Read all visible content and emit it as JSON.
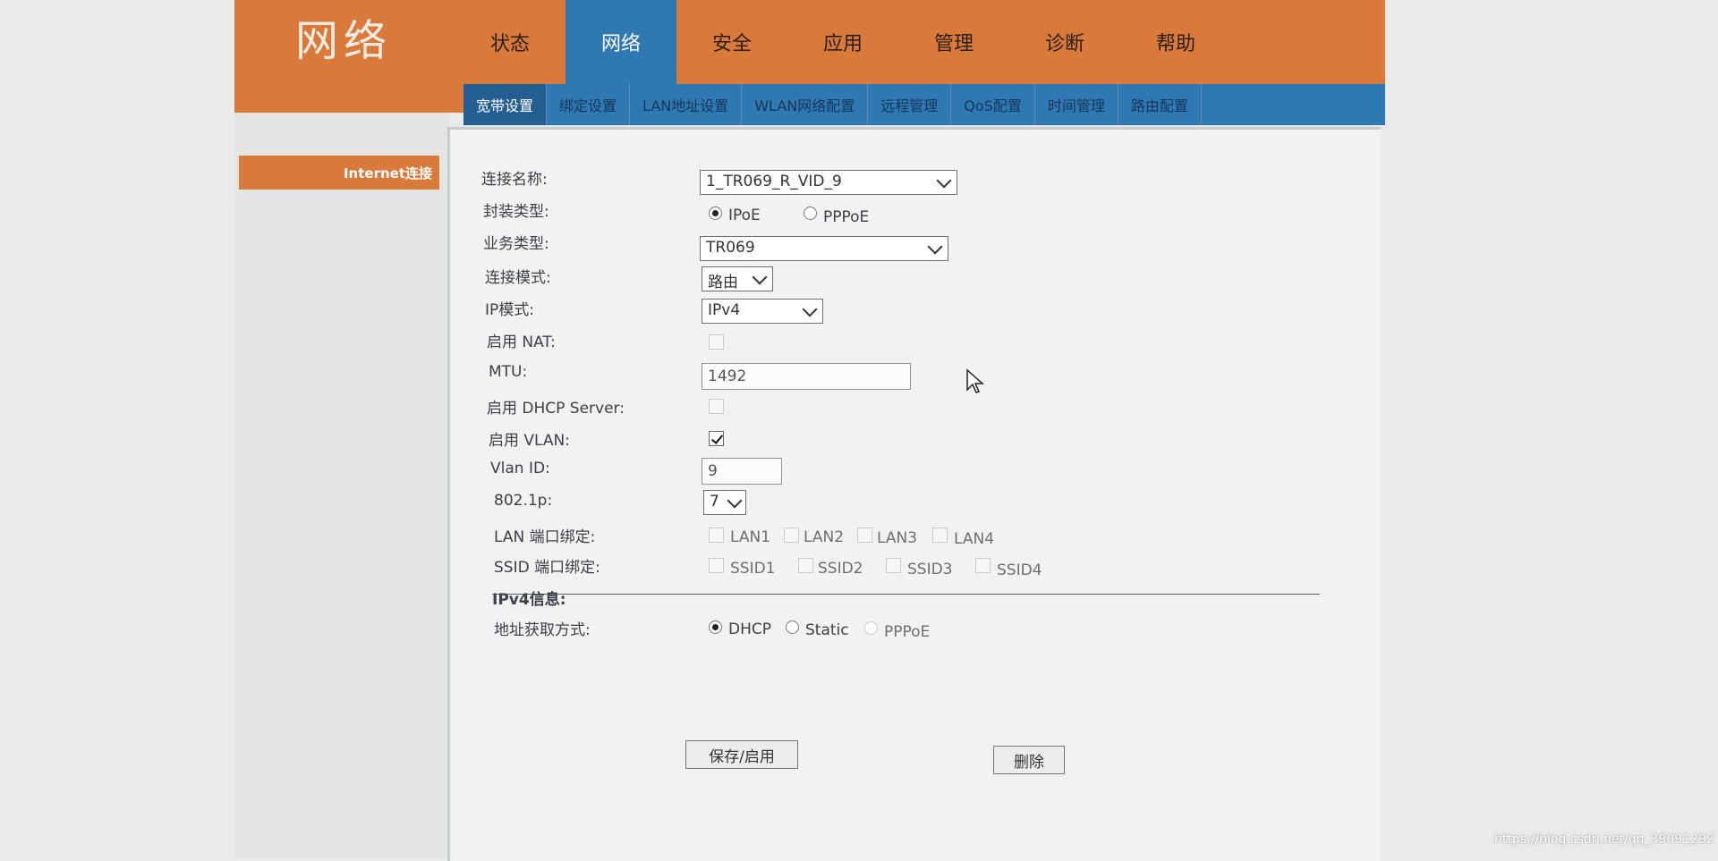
{
  "header": {
    "brand": "网络",
    "tabs": [
      "状态",
      "网络",
      "安全",
      "应用",
      "管理",
      "诊断",
      "帮助"
    ],
    "active_tab": "网络"
  },
  "sub_nav": {
    "items": [
      "宽带设置",
      "绑定设置",
      "LAN地址设置",
      "WLAN网络配置",
      "远程管理",
      "QoS配置",
      "时间管理",
      "路由配置"
    ],
    "active": "宽带设置"
  },
  "sidebar": {
    "items": [
      "Internet连接"
    ]
  },
  "form": {
    "connection_name": {
      "label": "连接名称:",
      "value": "1_TR069_R_VID_9"
    },
    "encap_type": {
      "label": "封装类型:",
      "options": [
        "IPoE",
        "PPPoE"
      ],
      "selected": "IPoE"
    },
    "service_type": {
      "label": "业务类型:",
      "value": "TR069"
    },
    "connection_mode": {
      "label": "连接模式:",
      "value": "路由"
    },
    "ip_mode": {
      "label": "IP模式:",
      "value": "IPv4"
    },
    "nat": {
      "label": "启用 NAT:",
      "checked": false
    },
    "mtu": {
      "label": "MTU:",
      "value": "1492"
    },
    "dhcp_server": {
      "label": "启用 DHCP Server:",
      "checked": false
    },
    "vlan": {
      "label": "启用 VLAN:",
      "checked": true
    },
    "vlan_id": {
      "label": "Vlan ID:",
      "value": "9"
    },
    "dot1p": {
      "label": "802.1p:",
      "value": "7"
    },
    "lan_bind": {
      "label": "LAN 端口绑定:",
      "ports": [
        "LAN1",
        "LAN2",
        "LAN3",
        "LAN4"
      ]
    },
    "ssid_bind": {
      "label": "SSID 端口绑定:",
      "ports": [
        "SSID1",
        "SSID2",
        "SSID3",
        "SSID4"
      ]
    },
    "ipv4_section": "IPv4信息:",
    "addr_method": {
      "label": "地址获取方式:",
      "options": [
        "DHCP",
        "Static",
        "PPPoE"
      ],
      "selected": "DHCP"
    }
  },
  "buttons": {
    "save": "保存/启用",
    "delete": "删除"
  },
  "watermark": "https://blog.csdn.net/qq_39091292"
}
